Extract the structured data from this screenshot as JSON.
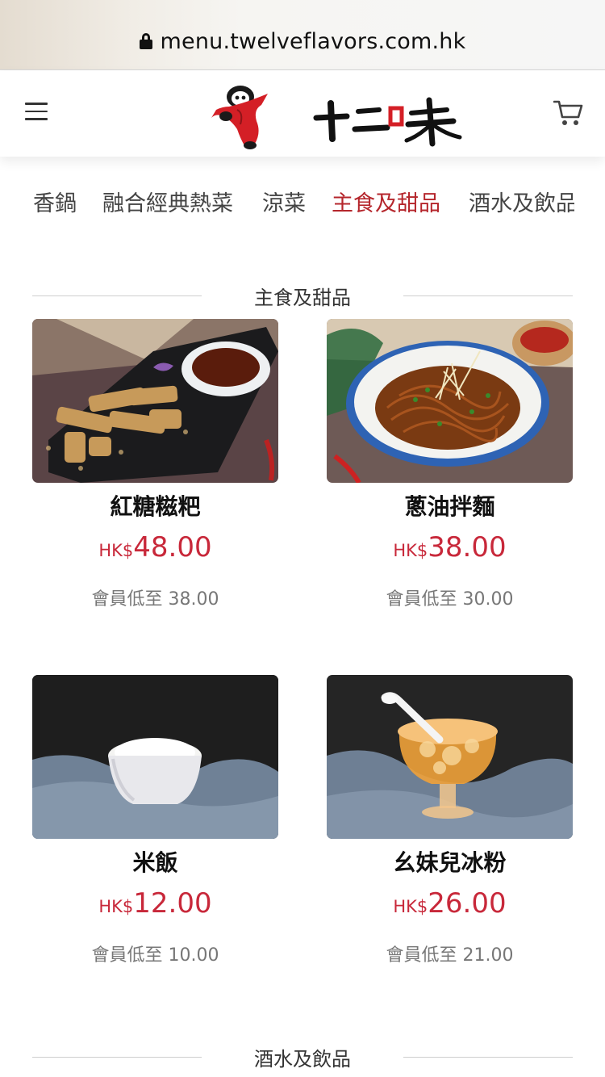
{
  "browser": {
    "url": "menu.twelveflavors.com.hk"
  },
  "header": {
    "logo_text": "十二味"
  },
  "category_nav": {
    "tabs": [
      {
        "label": "香鍋",
        "active": false
      },
      {
        "label": "融合經典熱菜",
        "active": false
      },
      {
        "label": "涼菜",
        "active": false
      },
      {
        "label": "主食及甜品",
        "active": true
      },
      {
        "label": "酒水及飲品",
        "active": false
      }
    ]
  },
  "sections": [
    {
      "title": "主食及甜品",
      "products": [
        {
          "name": "紅糖糍粑",
          "currency": "HK$",
          "price": "48.00",
          "member_price": "會員低至 38.00",
          "image": "brown-sugar-rice-cake-photo"
        },
        {
          "name": "蔥油拌麵",
          "currency": "HK$",
          "price": "38.00",
          "member_price": "會員低至 30.00",
          "image": "scallion-oil-noodles-photo"
        },
        {
          "name": "米飯",
          "currency": "HK$",
          "price": "12.00",
          "member_price": "會員低至 10.00",
          "image": "steamed-rice-photo"
        },
        {
          "name": "幺妹兒冰粉",
          "currency": "HK$",
          "price": "26.00",
          "member_price": "會員低至 21.00",
          "image": "ice-jelly-dessert-photo"
        }
      ]
    },
    {
      "title": "酒水及飲品"
    }
  ],
  "colors": {
    "accent": "#b5262c",
    "price": "#c8283a"
  }
}
